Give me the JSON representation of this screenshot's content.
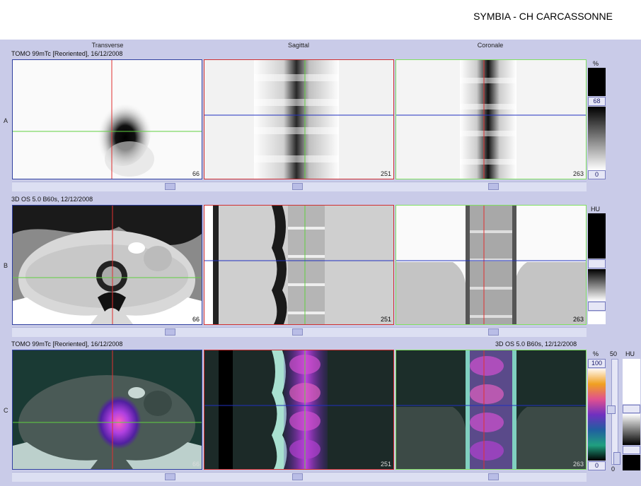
{
  "header": {
    "title": "SYMBIA - CH CARCASSONNE"
  },
  "columns": [
    "Transverse",
    "Sagittal",
    "Coronale"
  ],
  "rows": [
    {
      "letter": "A",
      "series": "TOMO 99mTc [Reoriented], 16/12/2008",
      "slices": [
        "66",
        "251",
        "263"
      ]
    },
    {
      "letter": "B",
      "series": "3D  OS  5.0  B60s, 12/12/2008",
      "slices": [
        "66",
        "251",
        "263"
      ]
    },
    {
      "letter": "C",
      "series": "TOMO 99mTc [Reoriented], 16/12/2008",
      "series_right": "3D  OS  5.0  B60s, 12/12/2008",
      "slices": [
        "66",
        "251",
        "263"
      ]
    }
  ],
  "scales": {
    "nm": {
      "unit": "%",
      "max": "68",
      "min": "0"
    },
    "ct": {
      "unit": "HU"
    },
    "fusion": {
      "unit_left": "%",
      "max": "100",
      "min": "0",
      "mid": "50",
      "unit_right": "HU",
      "mid_min": "0"
    }
  },
  "colors": {
    "background": "#c9cbe8",
    "transverse_frame": "#3040a0",
    "sagittal_frame": "#d03030",
    "coronal_frame": "#80e060"
  }
}
